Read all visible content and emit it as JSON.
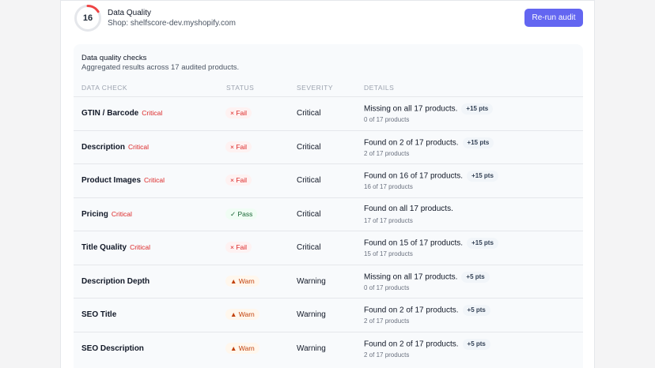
{
  "header": {
    "score": "16",
    "score_fraction": 0.16,
    "score_color": "#ef4444",
    "title": "Data Quality",
    "shop": "Shop: shelfscore-dev.myshopify.com",
    "rerun_label": "Re-run audit"
  },
  "panel": {
    "title": "Data quality checks",
    "subtitle": "Aggregated results across 17 audited products."
  },
  "columns": [
    "DATA CHECK",
    "STATUS",
    "SEVERITY",
    "DETAILS"
  ],
  "rows": [
    {
      "name": "GTIN / Barcode",
      "tag": "Critical",
      "status": "Fail",
      "status_icon": "×",
      "status_kind": "fail",
      "severity": "Critical",
      "detail": "Missing on all 17 products.",
      "pts": "+15 pts",
      "count": "0 of 17 products"
    },
    {
      "name": "Description",
      "tag": "Critical",
      "status": "Fail",
      "status_icon": "×",
      "status_kind": "fail",
      "severity": "Critical",
      "detail": "Found on 2 of 17 products.",
      "pts": "+15 pts",
      "count": "2 of 17 products"
    },
    {
      "name": "Product Images",
      "tag": "Critical",
      "status": "Fail",
      "status_icon": "×",
      "status_kind": "fail",
      "severity": "Critical",
      "detail": "Found on 16 of 17 products.",
      "pts": "+15 pts",
      "count": "16 of 17 products"
    },
    {
      "name": "Pricing",
      "tag": "Critical",
      "status": "Pass",
      "status_icon": "✓",
      "status_kind": "pass",
      "severity": "Critical",
      "detail": "Found on all 17 products.",
      "pts": "",
      "count": "17 of 17 products"
    },
    {
      "name": "Title Quality",
      "tag": "Critical",
      "status": "Fail",
      "status_icon": "×",
      "status_kind": "fail",
      "severity": "Critical",
      "detail": "Found on 15 of 17 products.",
      "pts": "+15 pts",
      "count": "15 of 17 products"
    },
    {
      "name": "Description Depth",
      "tag": "",
      "status": "Warn",
      "status_icon": "▲",
      "status_kind": "warn",
      "severity": "Warning",
      "detail": "Missing on all 17 products.",
      "pts": "+5 pts",
      "count": "0 of 17 products"
    },
    {
      "name": "SEO Title",
      "tag": "",
      "status": "Warn",
      "status_icon": "▲",
      "status_kind": "warn",
      "severity": "Warning",
      "detail": "Found on 2 of 17 products.",
      "pts": "+5 pts",
      "count": "2 of 17 products"
    },
    {
      "name": "SEO Description",
      "tag": "",
      "status": "Warn",
      "status_icon": "▲",
      "status_kind": "warn",
      "severity": "Warning",
      "detail": "Found on 2 of 17 products.",
      "pts": "+5 pts",
      "count": "2 of 17 products"
    }
  ]
}
